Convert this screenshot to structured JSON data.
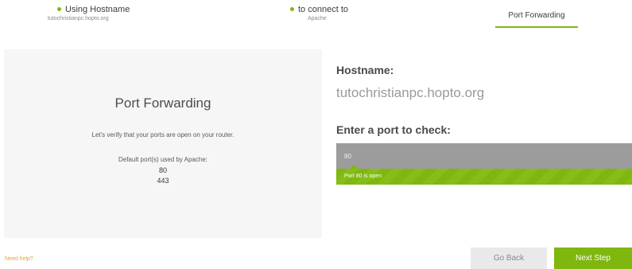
{
  "stepper": {
    "steps": [
      {
        "title": "Using Hostname",
        "subtitle": "tutochristianpc.hopto.org"
      },
      {
        "title": "to connect to",
        "subtitle": "Apache"
      },
      {
        "title": "Port Forwarding"
      }
    ],
    "active_index": 2
  },
  "left_panel": {
    "title": "Port Forwarding",
    "description": "Let's verify that your ports are open on your router.",
    "default_ports_label": "Default port(s) used by Apache:",
    "ports": [
      "80",
      "443"
    ]
  },
  "right_panel": {
    "hostname_label": "Hostname:",
    "hostname_value": "tutochristianpc.hopto.org",
    "port_label": "Enter a port to check:",
    "port_value": "80",
    "status_text": "Port 80 is open"
  },
  "footer": {
    "need_help": "Need help?",
    "back_label": "Go Back",
    "next_label": "Next Step"
  },
  "colors": {
    "accent": "#7fb70f",
    "input_bg": "#9c9c9c",
    "panel_bg": "#f6f6f6",
    "help_link": "#e0a43a"
  }
}
